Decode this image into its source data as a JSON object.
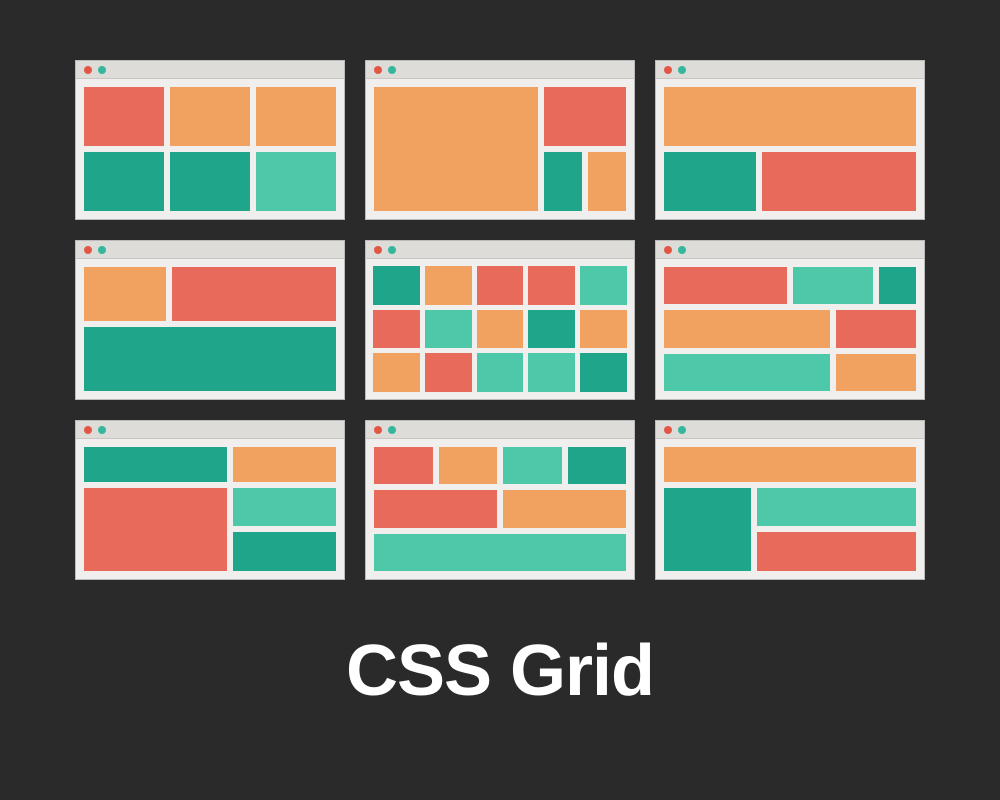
{
  "title": "CSS Grid",
  "colors": {
    "red": "#e86a5b",
    "orange": "#f1a160",
    "teal_dark": "#1fa58a",
    "teal_light": "#4dc9a9",
    "bg": "#2a2a2a",
    "window_bg": "#f0efed",
    "titlebar": "#dedcd8"
  },
  "layouts": [
    {
      "id": 1,
      "blocks": [
        "red",
        "orange",
        "orange",
        "teal",
        "teal",
        "teal_light"
      ]
    },
    {
      "id": 2,
      "blocks": [
        "red_wide_top",
        "orange_tall_right",
        "teal_orange_bottom"
      ]
    },
    {
      "id": 3,
      "blocks": [
        "orange_full_top",
        "teal_left",
        "red_right"
      ]
    },
    {
      "id": 4,
      "blocks": [
        "orange_left",
        "red_right",
        "teal_full_bottom"
      ]
    },
    {
      "id": 5,
      "blocks_grid_5x3": [
        "teal",
        "orange",
        "red",
        "red",
        "teal_light",
        "red",
        "teal_light",
        "orange",
        "teal",
        "orange",
        "orange",
        "red",
        "teal_light",
        "teal_light",
        "teal"
      ]
    },
    {
      "id": 6,
      "rows": [
        [
          "red",
          "teal_light",
          "teal"
        ],
        [
          "orange",
          "red"
        ],
        [
          "teal_light",
          "orange"
        ]
      ]
    },
    {
      "id": 7,
      "blocks": [
        "teal_top_left",
        "orange_top_right",
        "red_big_bottom_left",
        "teal_light_mid_right",
        "teal_bottom_right"
      ]
    },
    {
      "id": 8,
      "rows": [
        [
          "red",
          "orange",
          "teal_light",
          "teal"
        ],
        [
          "red_wide",
          "orange_wide"
        ],
        [
          "teal_light_full"
        ]
      ]
    },
    {
      "id": 9,
      "rows": [
        [
          "orange_full"
        ],
        [
          "teal",
          "teal_light"
        ],
        [
          "orange",
          "red"
        ]
      ]
    }
  ]
}
